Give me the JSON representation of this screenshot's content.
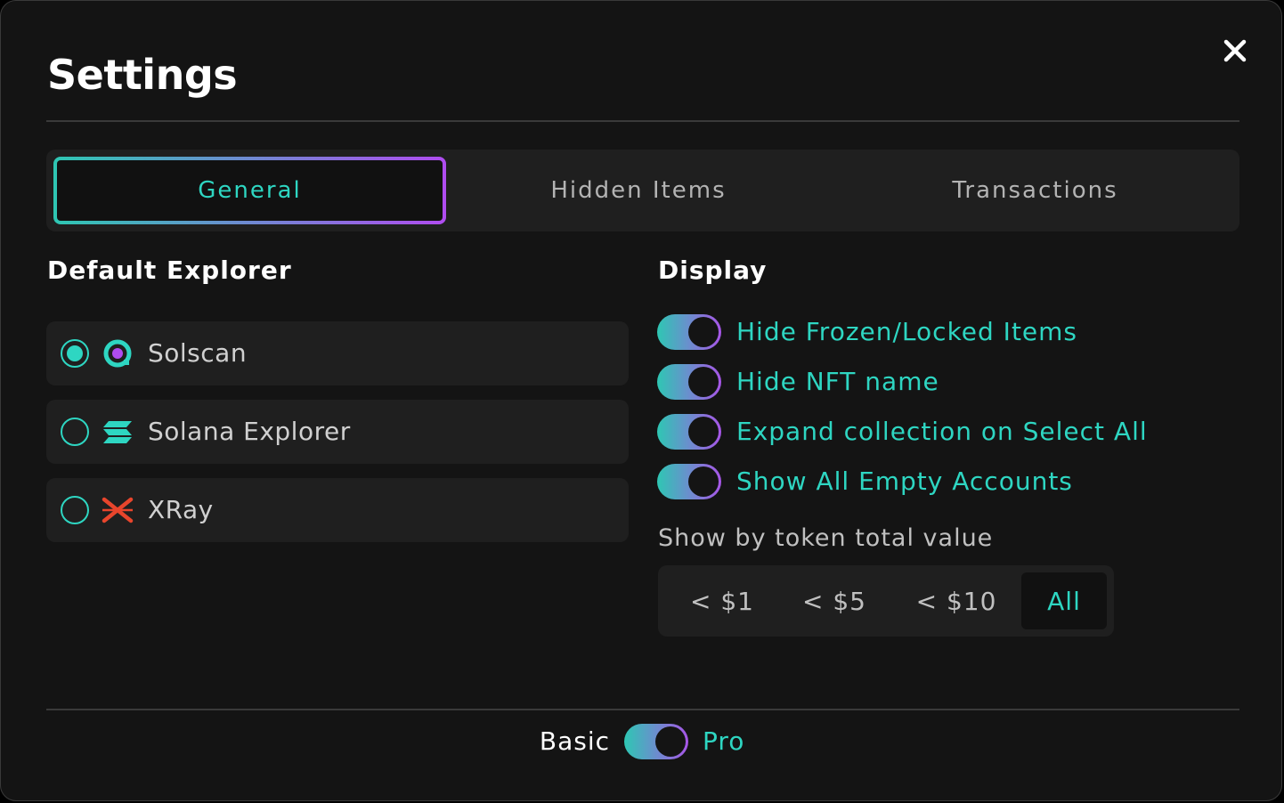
{
  "settings": {
    "title": "Settings",
    "tabs": [
      {
        "label": "General",
        "active": true
      },
      {
        "label": "Hidden Items",
        "active": false
      },
      {
        "label": "Transactions",
        "active": false
      }
    ],
    "explorer": {
      "heading": "Default Explorer",
      "options": [
        {
          "label": "Solscan",
          "icon": "solscan-icon",
          "selected": true
        },
        {
          "label": "Solana Explorer",
          "icon": "solana-icon",
          "selected": false
        },
        {
          "label": "XRay",
          "icon": "xray-icon",
          "selected": false
        }
      ]
    },
    "display": {
      "heading": "Display",
      "toggles": [
        {
          "label": "Hide Frozen/Locked Items",
          "on": true
        },
        {
          "label": "Hide NFT name",
          "on": true
        },
        {
          "label": "Expand collection on Select All",
          "on": true
        },
        {
          "label": "Show All Empty Accounts",
          "on": true
        }
      ],
      "token_filter_label": "Show by token total value",
      "token_filters": [
        {
          "label": "< $1",
          "active": false
        },
        {
          "label": "< $5",
          "active": false
        },
        {
          "label": "< $10",
          "active": false
        },
        {
          "label": "All",
          "active": true
        }
      ]
    },
    "mode": {
      "basic_label": "Basic",
      "pro_label": "Pro",
      "pro_on": true
    }
  },
  "colors": {
    "accent_teal": "#2ed6c2",
    "accent_purple": "#b04cf0",
    "background": "#141414",
    "panel": "#1f1f1f"
  }
}
